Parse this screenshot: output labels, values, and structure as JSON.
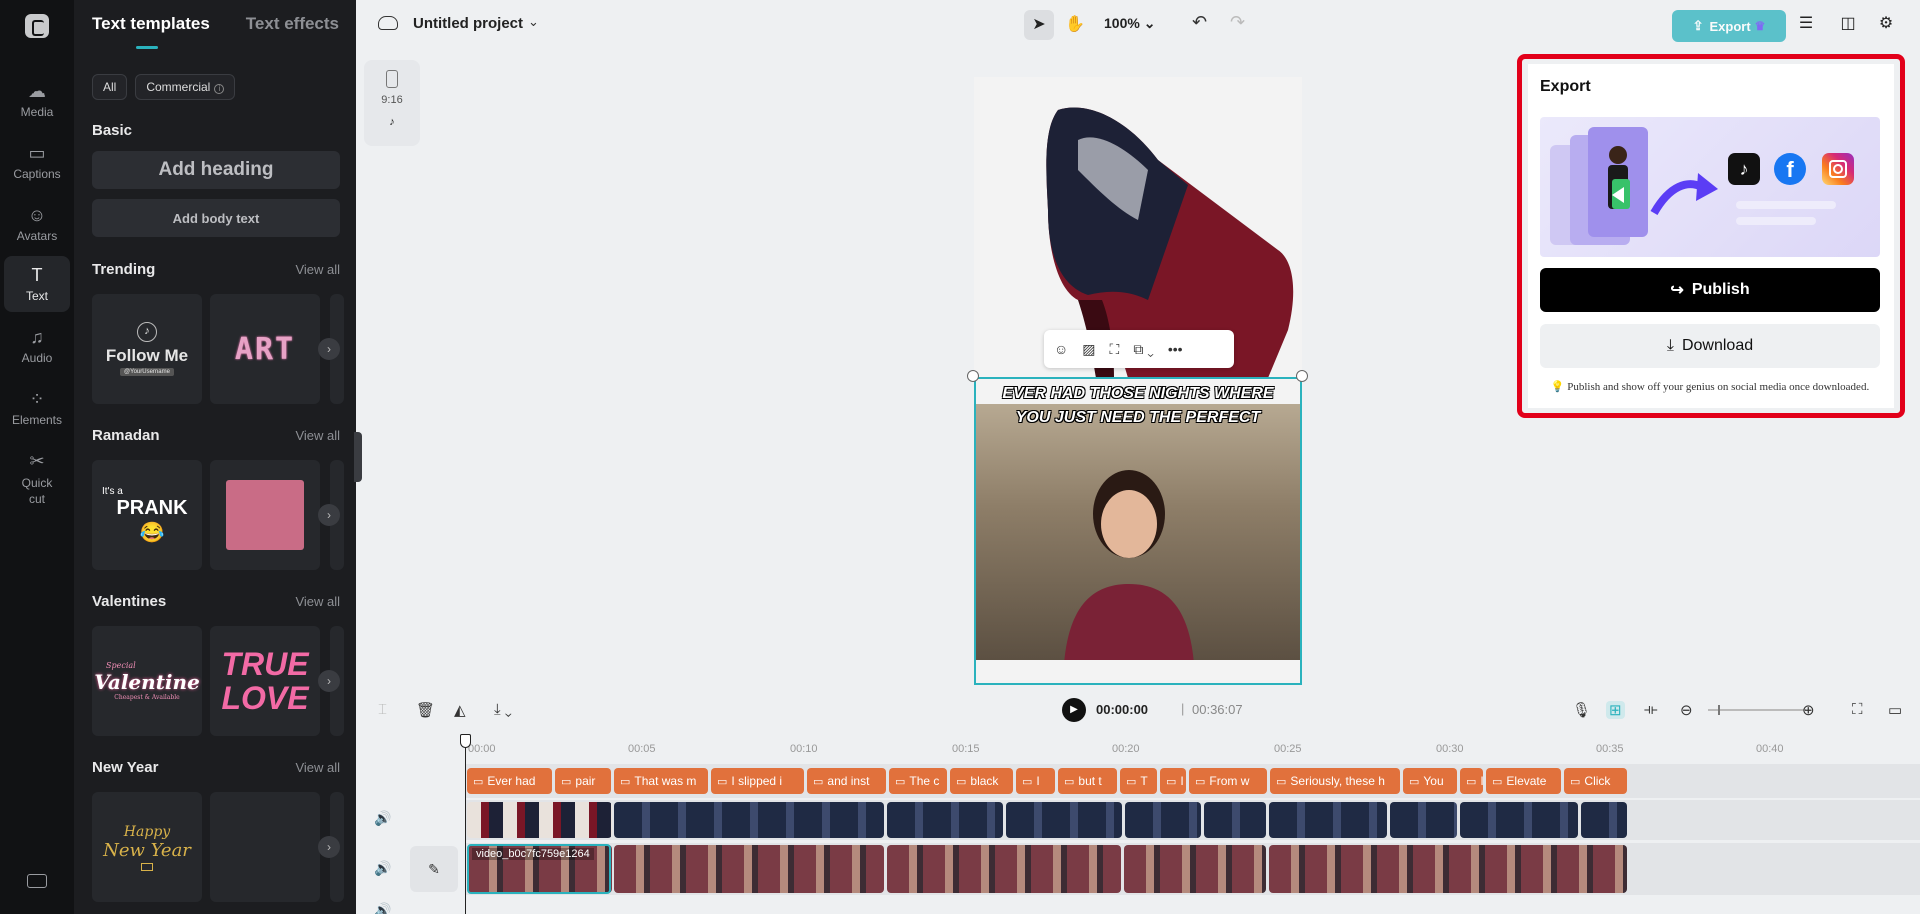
{
  "rail": {
    "items": [
      {
        "label": "Media",
        "icon": "media-icon"
      },
      {
        "label": "Captions",
        "icon": "captions-icon"
      },
      {
        "label": "Avatars",
        "icon": "avatars-icon"
      },
      {
        "label": "Text",
        "icon": "text-icon",
        "active": true
      },
      {
        "label": "Audio",
        "icon": "audio-icon"
      },
      {
        "label": "Elements",
        "icon": "elements-icon"
      },
      {
        "label": "Quick cut",
        "icon": "quick-cut-icon"
      }
    ]
  },
  "panel": {
    "tabs": [
      "Text templates",
      "Text effects"
    ],
    "filters": [
      "All",
      "Commercial"
    ],
    "basic": {
      "title": "Basic",
      "heading_btn": "Add heading",
      "body_btn": "Add body text"
    },
    "sections": [
      {
        "title": "Trending",
        "view_all": "View all"
      },
      {
        "title": "Ramadan",
        "view_all": "View all"
      },
      {
        "title": "Valentines",
        "view_all": "View all"
      },
      {
        "title": "New Year",
        "view_all": "View all"
      }
    ],
    "tiles": {
      "follow": {
        "big": "Follow Me",
        "small": "@YourUsername"
      },
      "art": "ART",
      "prank": {
        "s": "It's a",
        "b": "PRANK 😂"
      },
      "valentine": {
        "sp": "Special",
        "v": "Valentine",
        "c": "Cheapest & Available"
      },
      "truelove": {
        "l1": "TRUE",
        "l2": "LOVE"
      },
      "newyear": {
        "h": "Happy",
        "n": "New Year"
      }
    }
  },
  "topbar": {
    "project_title": "Untitled project",
    "zoom": "100%",
    "export_label": "Export"
  },
  "canvas": {
    "ratio": "9:16",
    "caption_line1": "EVER HAD THOSE NIGHTS WHERE",
    "caption_line2": "YOU JUST NEED THE PERFECT"
  },
  "timeline": {
    "current_time": "00:00:00",
    "separator": "|",
    "total_time": "00:36:07",
    "ruler": [
      "00:00",
      "00:05",
      "00:10",
      "00:15",
      "00:20",
      "00:25",
      "00:30",
      "00:35",
      "00:40"
    ],
    "caption_clips": [
      "Ever had",
      "pair",
      "That was m",
      "I slipped i",
      "and inst",
      "The c",
      "black",
      "I",
      "but t",
      "T",
      "I",
      "From w",
      "Seriously, these h",
      "You",
      "I",
      "Elevate",
      "Click"
    ],
    "main_clip_label": "video_b0c7fc759e1264"
  },
  "export_panel": {
    "title": "Export",
    "publish_label": "Publish",
    "download_label": "Download",
    "note": "Publish and show off your genius on social media once downloaded.",
    "highlight_color": "#e2001a"
  }
}
